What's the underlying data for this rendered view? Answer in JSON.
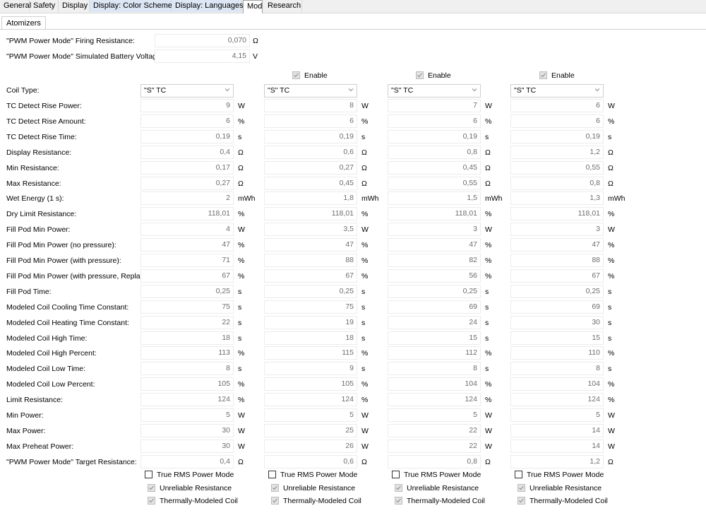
{
  "tabs": [
    "General",
    "Safety",
    "Display",
    "Display: Color Schemes",
    "Display: Languages",
    "Mod",
    "Research"
  ],
  "subtab": "Atomizers",
  "top_settings": [
    {
      "label": "\"PWM Power Mode\" Firing Resistance:",
      "value": "0,070",
      "unit": "Ω"
    },
    {
      "label": "\"PWM Power Mode\" Simulated Battery Voltage:",
      "value": "4,15",
      "unit": "V"
    }
  ],
  "enable_label": "Enable",
  "coil_type_label": "Coil Type:",
  "coil_types": [
    "\"S\" TC",
    "\"S\" TC",
    "\"S\" TC",
    "\"S\" TC"
  ],
  "rows": [
    {
      "label": "TC Detect Rise Power:",
      "values": [
        "9",
        "8",
        "7",
        "6"
      ],
      "units": [
        "W",
        "W",
        "W",
        "W"
      ]
    },
    {
      "label": "TC Detect Rise Amount:",
      "values": [
        "6",
        "6",
        "6",
        "6"
      ],
      "units": [
        "%",
        "%",
        "%",
        "%"
      ]
    },
    {
      "label": "TC Detect Rise Time:",
      "values": [
        "0,19",
        "0,19",
        "0,19",
        "0,19"
      ],
      "units": [
        "s",
        "s",
        "s",
        "s"
      ]
    },
    {
      "label": "Display Resistance:",
      "values": [
        "0,4",
        "0,6",
        "0,8",
        "1,2"
      ],
      "units": [
        "Ω",
        "Ω",
        "Ω",
        "Ω"
      ]
    },
    {
      "label": "Min Resistance:",
      "values": [
        "0,17",
        "0,27",
        "0,45",
        "0,55"
      ],
      "units": [
        "Ω",
        "Ω",
        "Ω",
        "Ω"
      ]
    },
    {
      "label": "Max Resistance:",
      "values": [
        "0,27",
        "0,45",
        "0,55",
        "0,8"
      ],
      "units": [
        "Ω",
        "Ω",
        "Ω",
        "Ω"
      ]
    },
    {
      "label": "Wet Energy (1 s):",
      "values": [
        "2",
        "1,8",
        "1,5",
        "1,3"
      ],
      "units": [
        "mWh",
        "mWh",
        "mWh",
        "mWh"
      ]
    },
    {
      "label": "Dry Limit Resistance:",
      "values": [
        "118,01",
        "118,01",
        "118,01",
        "118,01"
      ],
      "units": [
        "%",
        "%",
        "%",
        "%"
      ]
    },
    {
      "label": "Fill Pod Min Power:",
      "values": [
        "4",
        "3,5",
        "3",
        "3"
      ],
      "units": [
        "W",
        "W",
        "W",
        "W"
      ]
    },
    {
      "label": "Fill Pod Min Power (no pressure):",
      "values": [
        "47",
        "47",
        "47",
        "47"
      ],
      "units": [
        "%",
        "%",
        "%",
        "%"
      ]
    },
    {
      "label": "Fill Pod Min Power (with pressure):",
      "values": [
        "71",
        "88",
        "82",
        "88"
      ],
      "units": [
        "%",
        "%",
        "%",
        "%"
      ]
    },
    {
      "label": "Fill Pod Min Power (with pressure, Replay):",
      "values": [
        "67",
        "67",
        "56",
        "67"
      ],
      "units": [
        "%",
        "%",
        "%",
        "%"
      ]
    },
    {
      "label": "Fill Pod Time:",
      "values": [
        "0,25",
        "0,25",
        "0,25",
        "0,25"
      ],
      "units": [
        "s",
        "s",
        "s",
        "s"
      ]
    },
    {
      "label": "Modeled Coil Cooling Time Constant:",
      "values": [
        "75",
        "75",
        "69",
        "69"
      ],
      "units": [
        "s",
        "s",
        "s",
        "s"
      ]
    },
    {
      "label": "Modeled Coil Heating Time Constant:",
      "values": [
        "22",
        "19",
        "24",
        "30"
      ],
      "units": [
        "s",
        "s",
        "s",
        "s"
      ]
    },
    {
      "label": "Modeled Coil High Time:",
      "values": [
        "18",
        "18",
        "15",
        "15"
      ],
      "units": [
        "s",
        "s",
        "s",
        "s"
      ]
    },
    {
      "label": "Modeled Coil High Percent:",
      "values": [
        "113",
        "115",
        "112",
        "110"
      ],
      "units": [
        "%",
        "%",
        "%",
        "%"
      ]
    },
    {
      "label": "Modeled Coil Low Time:",
      "values": [
        "8",
        "9",
        "8",
        "8"
      ],
      "units": [
        "s",
        "s",
        "s",
        "s"
      ]
    },
    {
      "label": "Modeled Coil Low Percent:",
      "values": [
        "105",
        "105",
        "104",
        "104"
      ],
      "units": [
        "%",
        "%",
        "%",
        "%"
      ]
    },
    {
      "label": "Limit Resistance:",
      "values": [
        "124",
        "124",
        "124",
        "124"
      ],
      "units": [
        "%",
        "%",
        "%",
        "%"
      ]
    },
    {
      "label": "Min Power:",
      "values": [
        "5",
        "5",
        "5",
        "5"
      ],
      "units": [
        "W",
        "W",
        "W",
        "W"
      ]
    },
    {
      "label": "Max Power:",
      "values": [
        "30",
        "25",
        "22",
        "14"
      ],
      "units": [
        "W",
        "W",
        "W",
        "W"
      ]
    },
    {
      "label": "Max Preheat Power:",
      "values": [
        "30",
        "26",
        "22",
        "14"
      ],
      "units": [
        "W",
        "W",
        "W",
        "W"
      ]
    },
    {
      "label": "\"PWM Power Mode\" Target Resistance:",
      "values": [
        "0,4",
        "0,6",
        "0,8",
        "1,2"
      ],
      "units": [
        "Ω",
        "Ω",
        "Ω",
        "Ω"
      ]
    }
  ],
  "checkboxes": [
    "True RMS Power Mode",
    "Unreliable Resistance",
    "Thermally-Modeled Coil"
  ],
  "colors": {
    "tab_highlight": "#dce6f4",
    "field_text": "#6d6d6d"
  }
}
